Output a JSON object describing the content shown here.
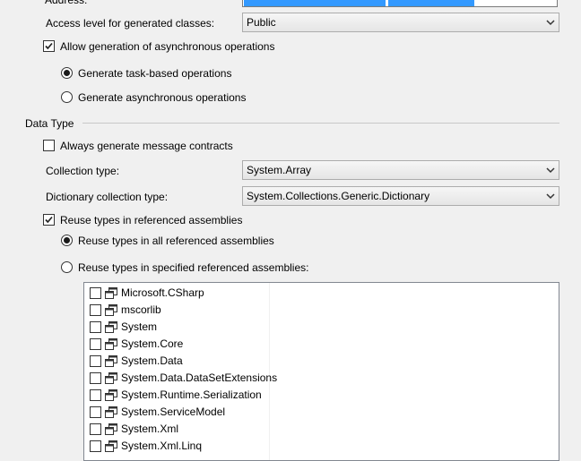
{
  "address": {
    "label": "Address:"
  },
  "access_level": {
    "label": "Access level for generated classes:",
    "value": "Public"
  },
  "async": {
    "allow_label": "Allow generation of asynchronous operations",
    "allow_checked": true,
    "task_based_label": "Generate task-based operations",
    "async_ops_label": "Generate asynchronous operations",
    "selected": "task_based"
  },
  "data_type": {
    "group_label": "Data Type",
    "message_contracts_label": "Always generate message contracts",
    "message_contracts_checked": false,
    "collection_type_label": "Collection type:",
    "collection_type_value": "System.Array",
    "dictionary_type_label": "Dictionary collection type:",
    "dictionary_type_value": "System.Collections.Generic.Dictionary",
    "reuse_label": "Reuse types in referenced assemblies",
    "reuse_checked": true,
    "reuse_all_label": "Reuse types in all referenced assemblies",
    "reuse_specified_label": "Reuse types in specified referenced assemblies:",
    "reuse_selected": "all"
  },
  "assemblies": [
    {
      "name": "Microsoft.CSharp",
      "checked": false
    },
    {
      "name": "mscorlib",
      "checked": false
    },
    {
      "name": "System",
      "checked": false
    },
    {
      "name": "System.Core",
      "checked": false
    },
    {
      "name": "System.Data",
      "checked": false
    },
    {
      "name": "System.Data.DataSetExtensions",
      "checked": false
    },
    {
      "name": "System.Runtime.Serialization",
      "checked": false
    },
    {
      "name": "System.ServiceModel",
      "checked": false
    },
    {
      "name": "System.Xml",
      "checked": false
    },
    {
      "name": "System.Xml.Linq",
      "checked": false
    }
  ]
}
